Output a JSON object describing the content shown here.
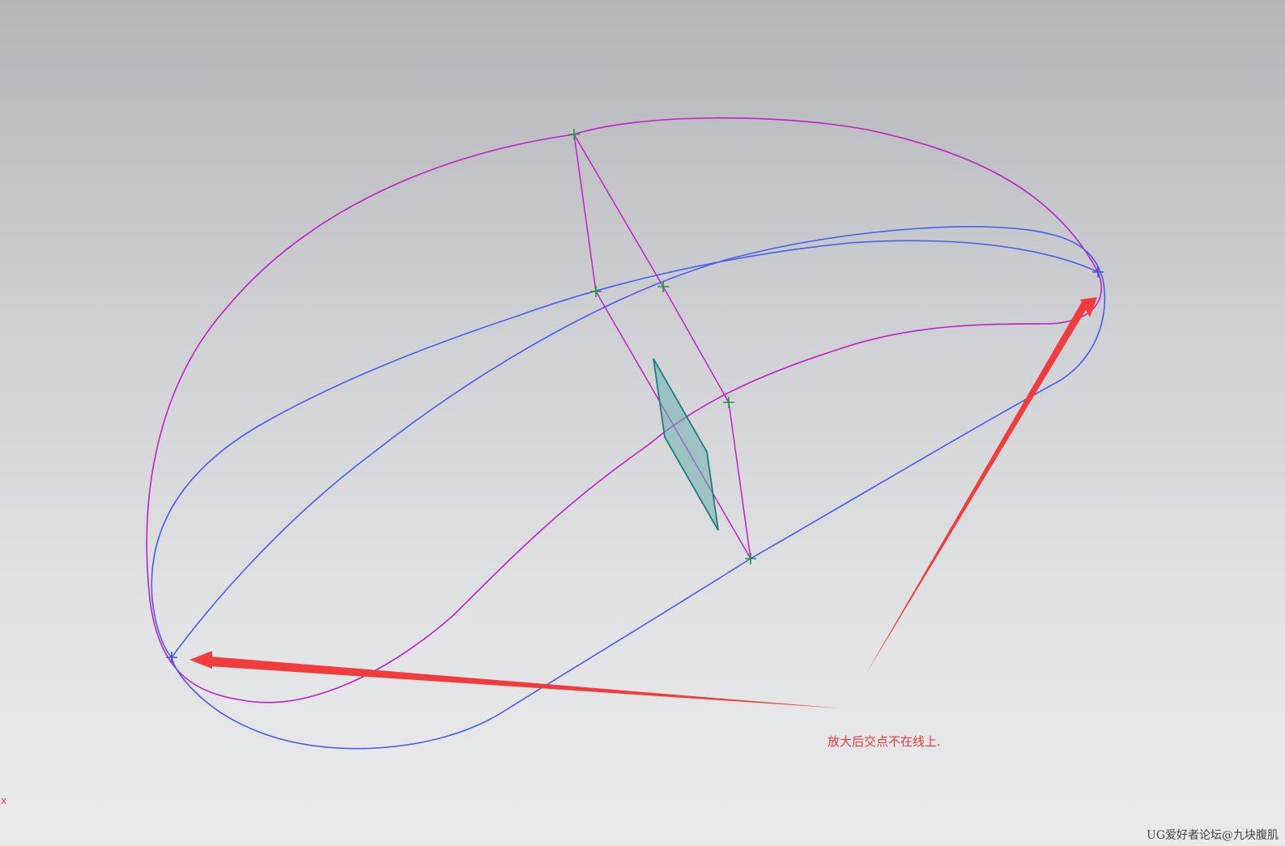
{
  "annotation": {
    "text": "放大后交点不在线上."
  },
  "axis": {
    "x_label": "x"
  },
  "watermark": {
    "text": "UG爱好者论坛@九块腹肌"
  },
  "colors": {
    "magenta_curve": "#c020c8",
    "blue_curve": "#4a5cf0",
    "surface_fill": "#6fb1b0",
    "surface_edge": "#1a7f7a",
    "point_green": "#1a9a3a",
    "point_blue": "#3a4ee8",
    "arrow_red": "#f03c3c"
  }
}
